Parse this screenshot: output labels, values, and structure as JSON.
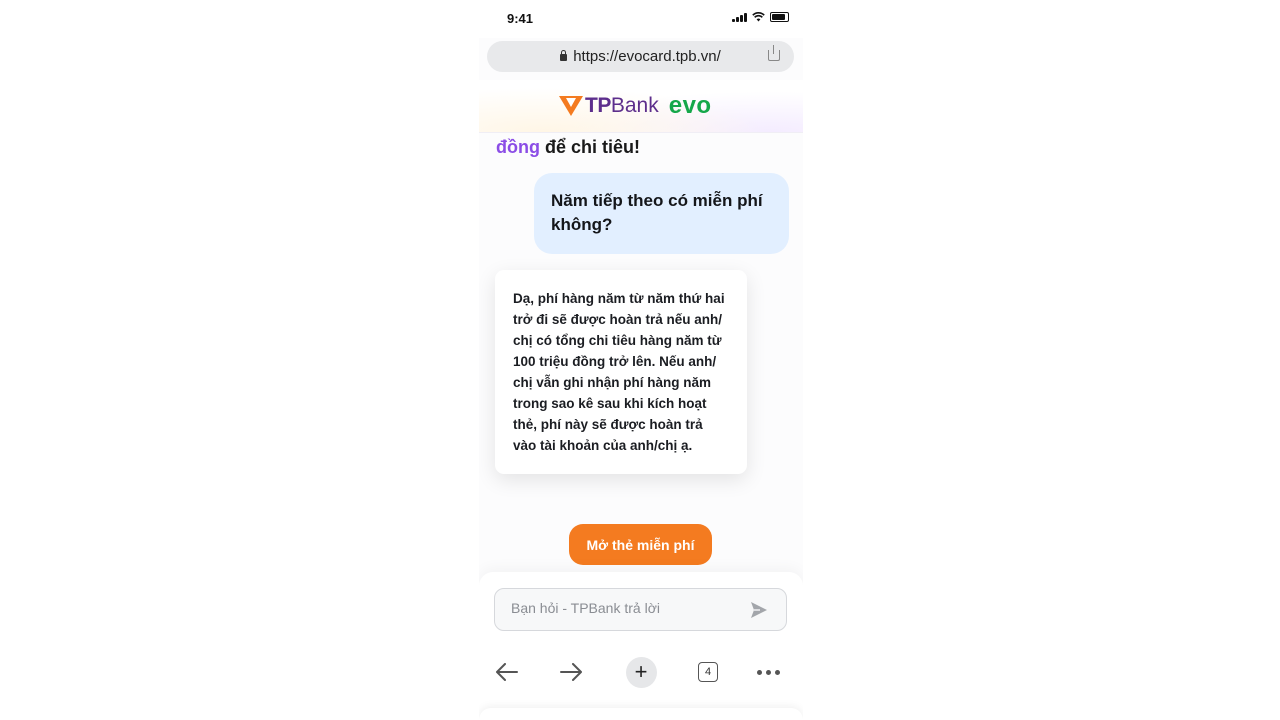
{
  "status_bar": {
    "time": "9:41"
  },
  "browser": {
    "url": "https://evocard.tpb.vn/",
    "tab_count": "4"
  },
  "brand": {
    "tp": "TP",
    "bank": "Bank",
    "evo": "evo"
  },
  "chat": {
    "previous_highlight": "đồng",
    "previous_rest": " để chi tiêu!",
    "user_message": "Năm tiếp theo có miễn phí không?",
    "bot_message": "Dạ, phí hàng năm từ năm thứ hai trở đi sẽ được hoàn trả nếu anh/ chị có tổng chi tiêu hàng năm từ 100 triệu đồng trở lên. Nếu anh/ chị vẫn ghi nhận phí hàng năm trong sao kê sau khi kích hoạt thẻ, phí này sẽ được hoàn trả vào tài khoản của anh/chị ạ."
  },
  "cta": {
    "label": "Mở thẻ miễn phí"
  },
  "composer": {
    "placeholder": "Bạn hỏi - TPBank trả lời"
  },
  "colors": {
    "accent": "#f47b20",
    "brand_purple": "#5d2e8c",
    "evo_green": "#15a74a",
    "user_bubble": "#e2efff",
    "highlight": "#8b4de6"
  }
}
